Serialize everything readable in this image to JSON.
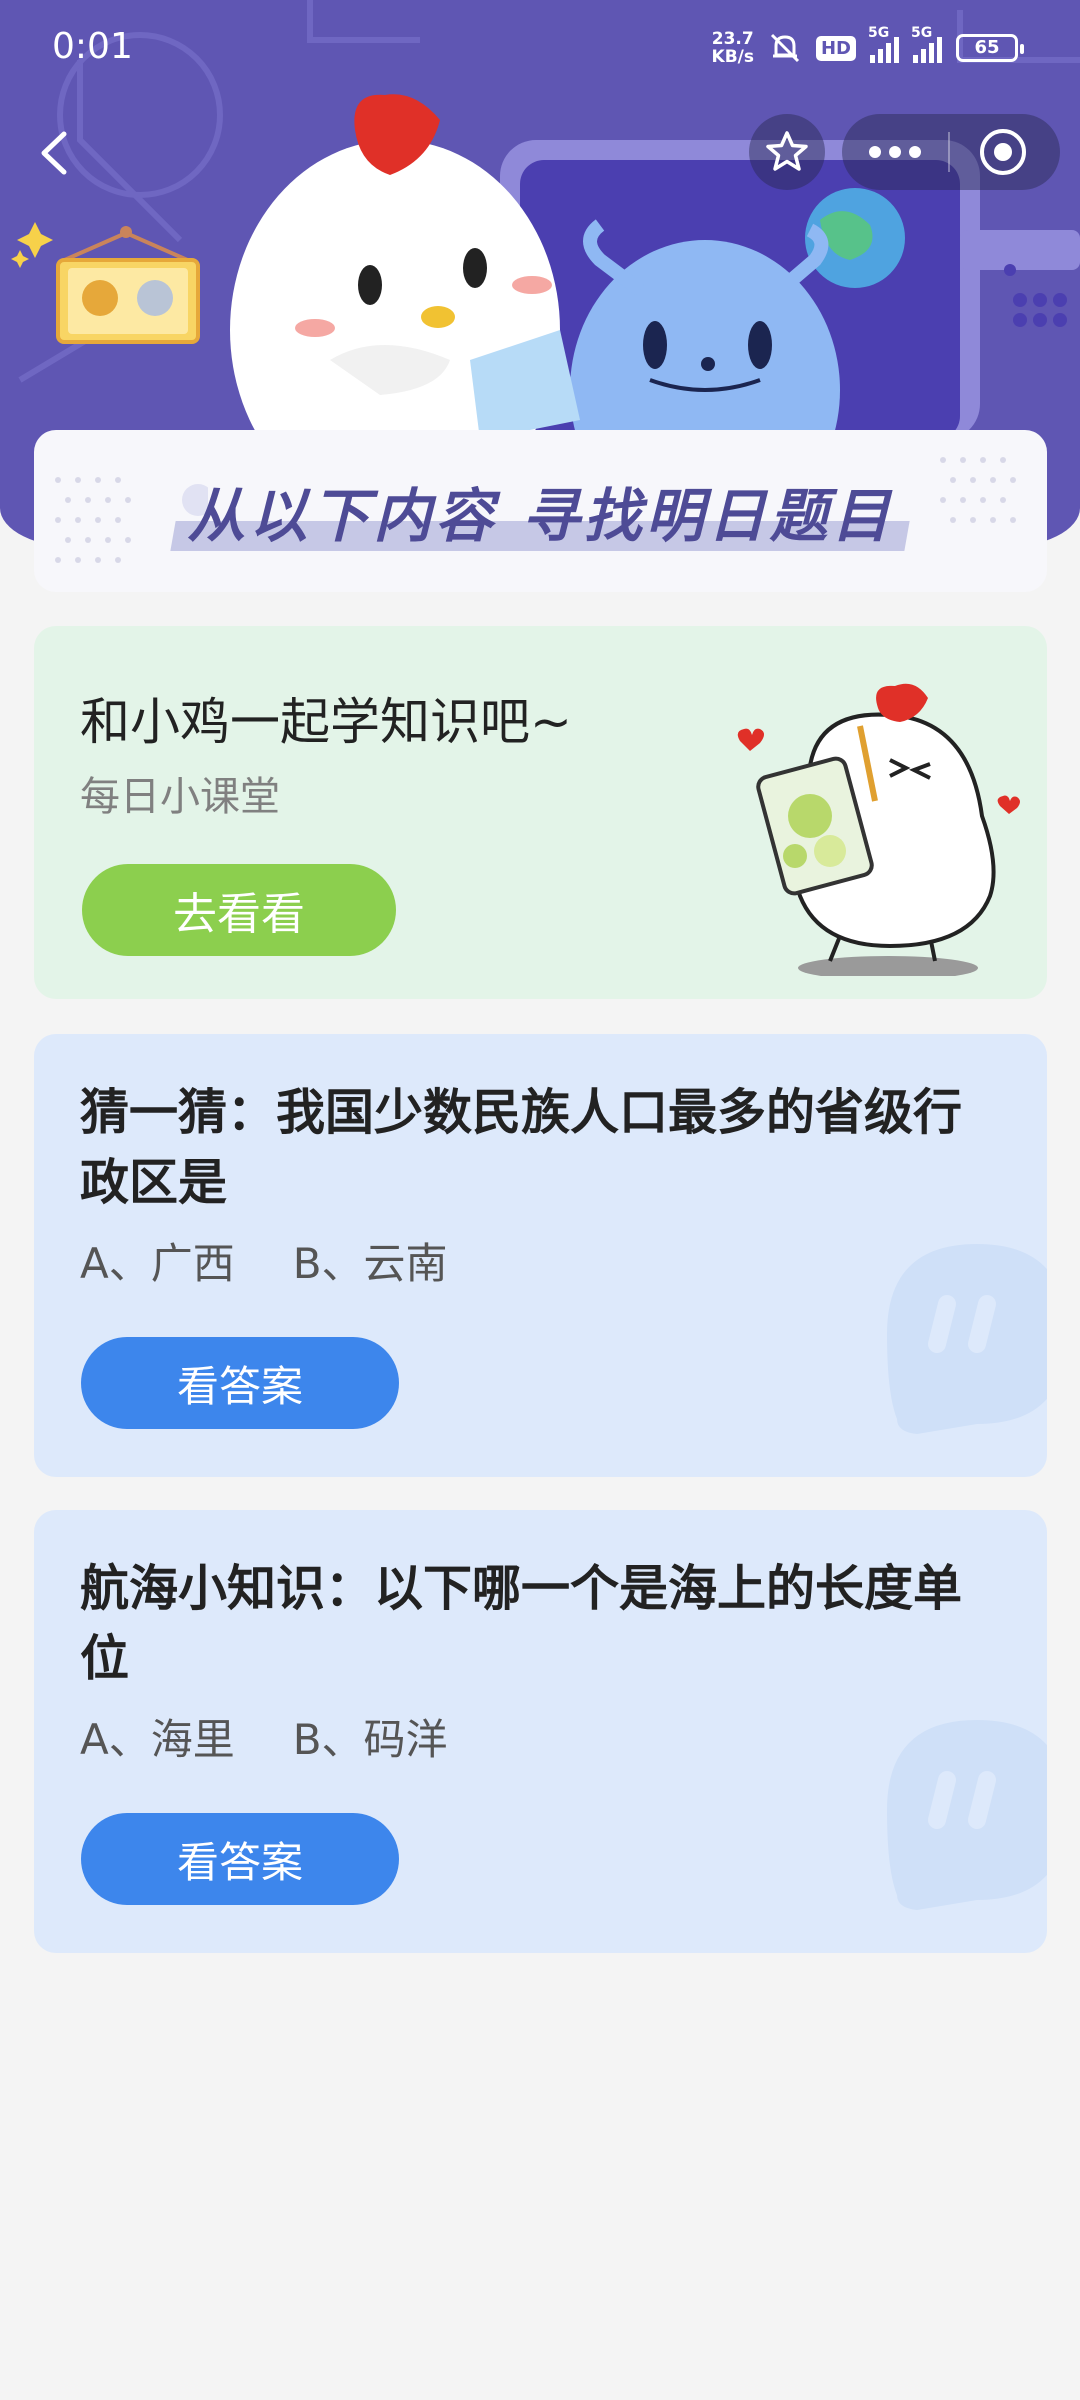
{
  "status_bar": {
    "time": "0:01",
    "net_speed": "23.7",
    "net_unit": "KB/s",
    "hd_badge": "HD",
    "signal1_label": "5G",
    "signal2_label": "5G",
    "battery": "65"
  },
  "banner": {
    "title": "从以下内容 寻找明日题目"
  },
  "learn_card": {
    "title": "和小鸡一起学知识吧~",
    "subtitle": "每日小课堂",
    "button": "去看看"
  },
  "questions": [
    {
      "text": "猜一猜：我国少数民族人口最多的省级行政区是",
      "options": [
        "A、广西",
        "B、云南"
      ],
      "button": "看答案"
    },
    {
      "text": "航海小知识：以下哪一个是海上的长度单位",
      "options": [
        "A、海里",
        "B、码洋"
      ],
      "button": "看答案"
    }
  ],
  "colors": {
    "header": "#5f56b3",
    "green_button": "#8ccf4e",
    "blue_button": "#3d86ec",
    "learn_card_bg": "#e3f4e8",
    "question_card_bg": "#dde9fb"
  }
}
